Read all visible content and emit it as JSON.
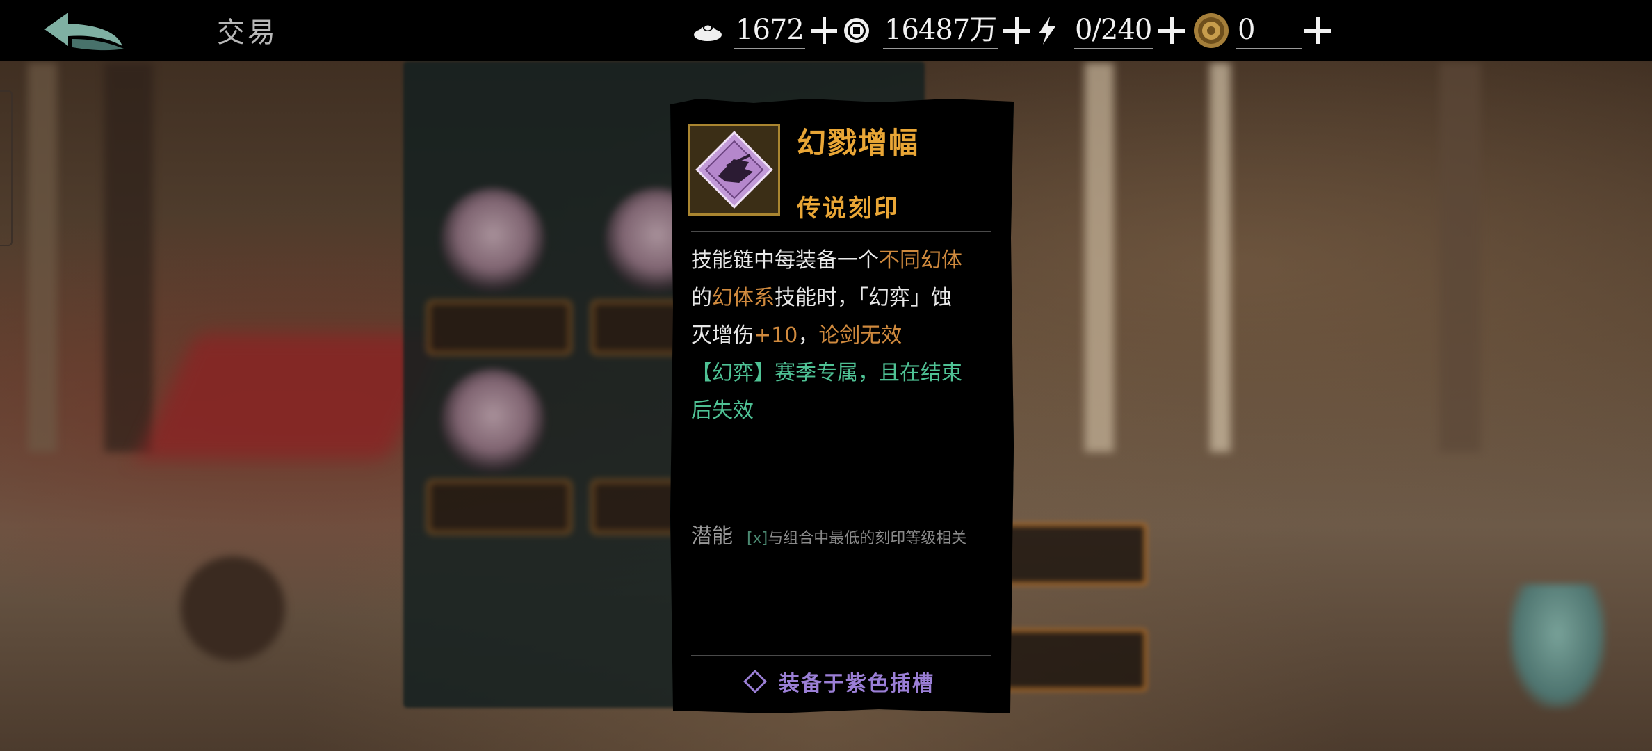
{
  "header": {
    "title": "交易"
  },
  "resources": [
    {
      "name": "silver-ingot",
      "icon": "ingot-icon",
      "value": "1672"
    },
    {
      "name": "coins",
      "icon": "coin-icon",
      "value": "16487万"
    },
    {
      "name": "stamina",
      "icon": "lightning-icon",
      "value": "0/240"
    },
    {
      "name": "gold-token",
      "icon": "token-icon",
      "value": "0"
    }
  ],
  "tooltip": {
    "item_name": "幻戮增幅",
    "rarity": "传说刻印",
    "desc": {
      "l1_a": "技能链中每装备一个",
      "l1_hl": "不同幻体",
      "l2_a": "的",
      "l2_hl": "幻体系",
      "l2_b": "技能时，「幻弈」蚀",
      "l3_a": "灭增伤",
      "l3_hl": "+10",
      "l3_b": "，",
      "l3_hl2": "论剑无效",
      "season_1": "【幻弈】赛季专属，且在结束",
      "season_2": "后失效"
    },
    "potential_label": "潜能",
    "potential_x": "[x]",
    "potential_note": "与组合中最低的刻印等级相关",
    "equip_label": "装备于紫色插槽"
  },
  "colors": {
    "gold": "#e9a636",
    "highlight": "#d08a3e",
    "season_green": "#4fc295",
    "purple": "#9b7fd6"
  }
}
